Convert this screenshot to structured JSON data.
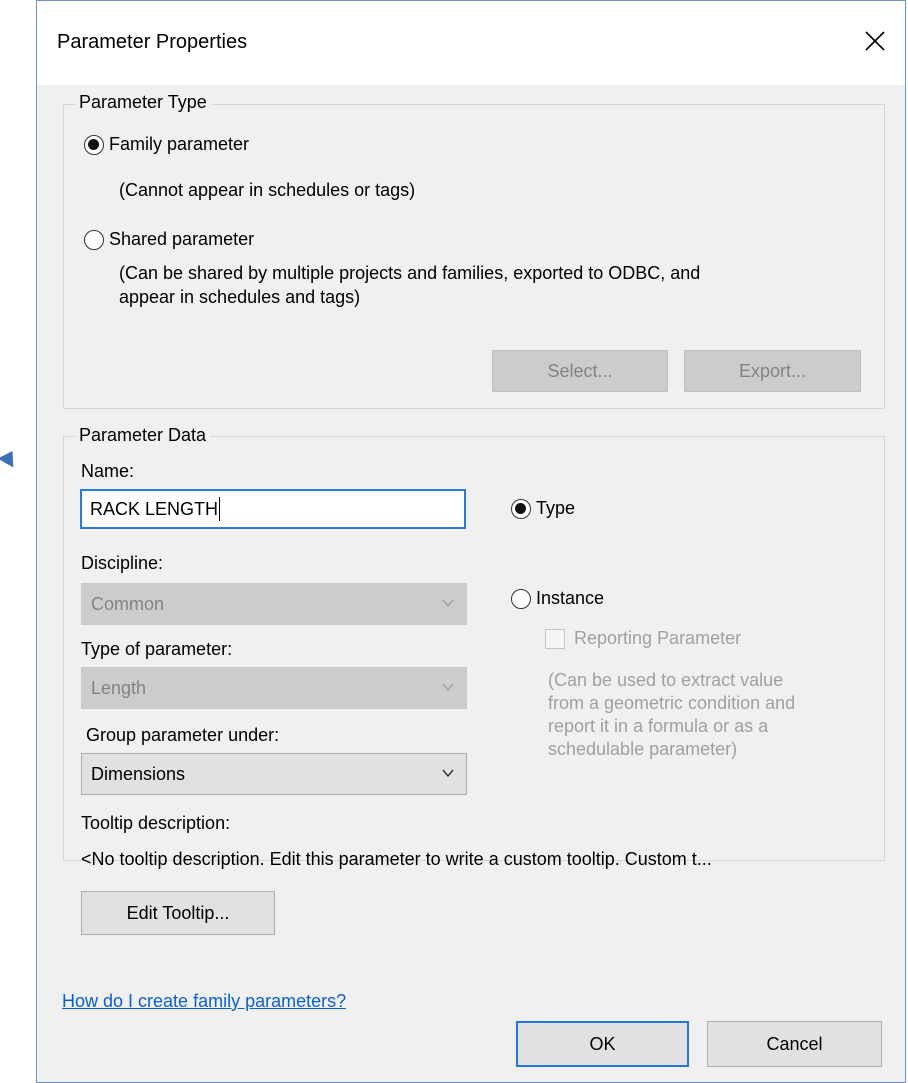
{
  "window": {
    "title": "Parameter Properties"
  },
  "parameter_type": {
    "legend": "Parameter Type",
    "family": {
      "label": "Family parameter",
      "note": "(Cannot appear in schedules or tags)",
      "checked": true
    },
    "shared": {
      "label": "Shared parameter",
      "note_line1": "(Can be shared by multiple projects and families, exported to ODBC, and",
      "note_line2": "appear in schedules and tags)",
      "checked": false
    },
    "select_label": "Select...",
    "export_label": "Export..."
  },
  "parameter_data": {
    "legend": "Parameter Data",
    "name_label": "Name:",
    "name_value": "RACK LENGTH",
    "discipline_label": "Discipline:",
    "discipline_value": "Common",
    "type_label": "Type of parameter:",
    "type_value": "Length",
    "group_label": "Group parameter under:",
    "group_value": "Dimensions",
    "type_radio_label": "Type",
    "instance_radio_label": "Instance",
    "reporting_label": "Reporting Parameter",
    "reporting_note": [
      "(Can be used to extract value",
      "from a geometric condition and",
      "report it in a formula or as a",
      "schedulable parameter)"
    ],
    "tooltip_label": "Tooltip description:",
    "tooltip_value": "<No tooltip description. Edit this parameter to write a custom tooltip. Custom t...",
    "edit_tooltip_label": "Edit Tooltip..."
  },
  "help_link": "How do I create family parameters?",
  "ok_label": "OK",
  "cancel_label": "Cancel",
  "colors": {
    "accent": "#2679d1",
    "link": "#0b5fd5",
    "disabled_text": "#838383"
  }
}
